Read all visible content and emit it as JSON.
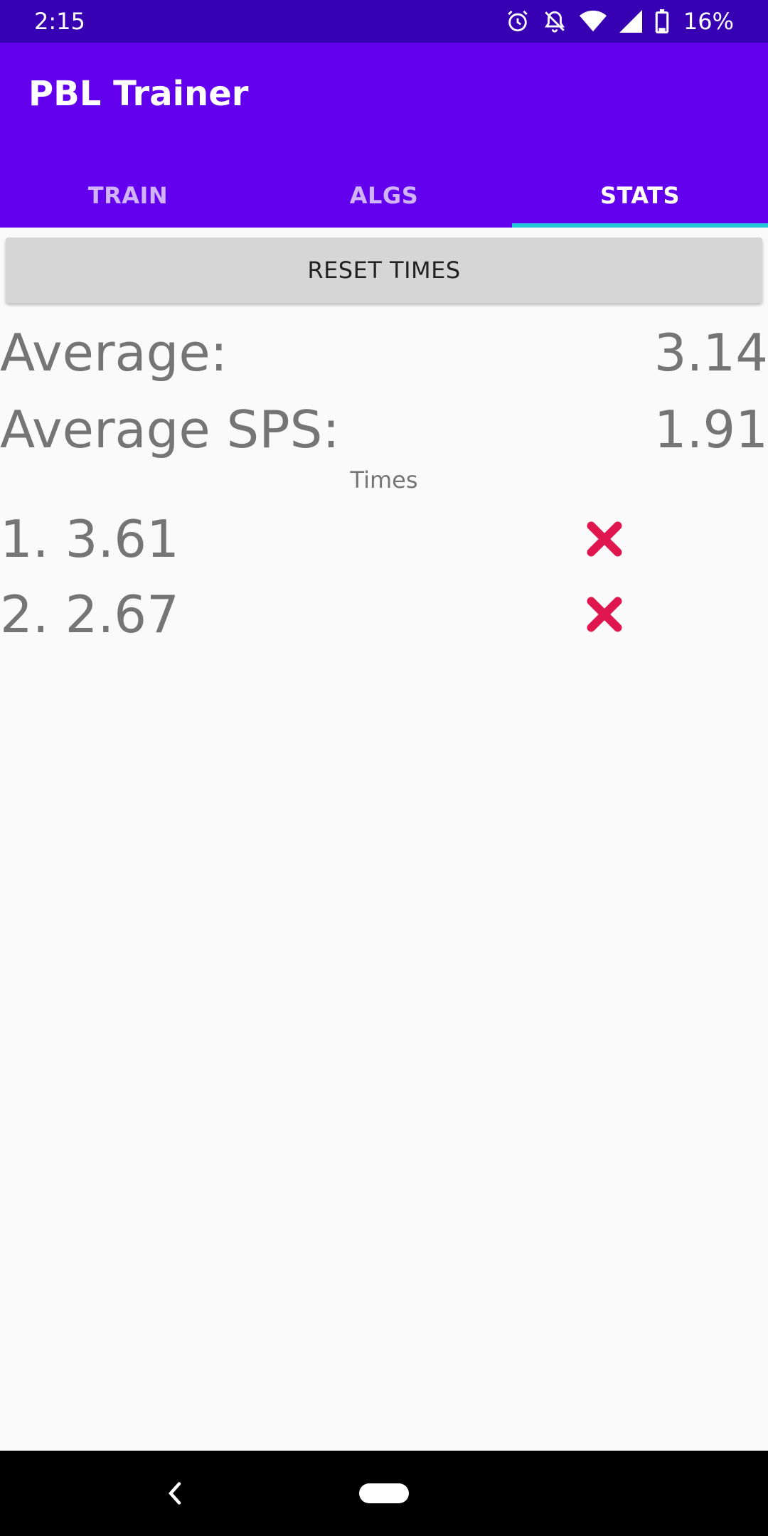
{
  "status_bar": {
    "time": "2:15",
    "battery": "16%",
    "icons": [
      "alarm-icon",
      "notifications-off-icon",
      "wifi-icon",
      "cell-signal-icon",
      "battery-icon"
    ]
  },
  "app": {
    "title": "PBL Trainer",
    "primary_color": "#6200ee",
    "status_color": "#3700b3",
    "indicator_color": "#26c6da"
  },
  "tabs": [
    {
      "label": "TRAIN",
      "active": false
    },
    {
      "label": "ALGS",
      "active": false
    },
    {
      "label": "STATS",
      "active": true
    }
  ],
  "stats": {
    "reset_label": "RESET TIMES",
    "average_label": "Average:",
    "average_value": "3.14",
    "sps_label": "Average SPS:",
    "sps_value": "1.91",
    "times_label": "Times",
    "times": [
      {
        "text": "1. 3.61",
        "icon": "close-icon"
      },
      {
        "text": "2. 2.67",
        "icon": "close-icon"
      }
    ],
    "delete_color": "#e0174f"
  },
  "nav": {
    "icons": [
      "back-icon",
      "home-pill"
    ]
  }
}
